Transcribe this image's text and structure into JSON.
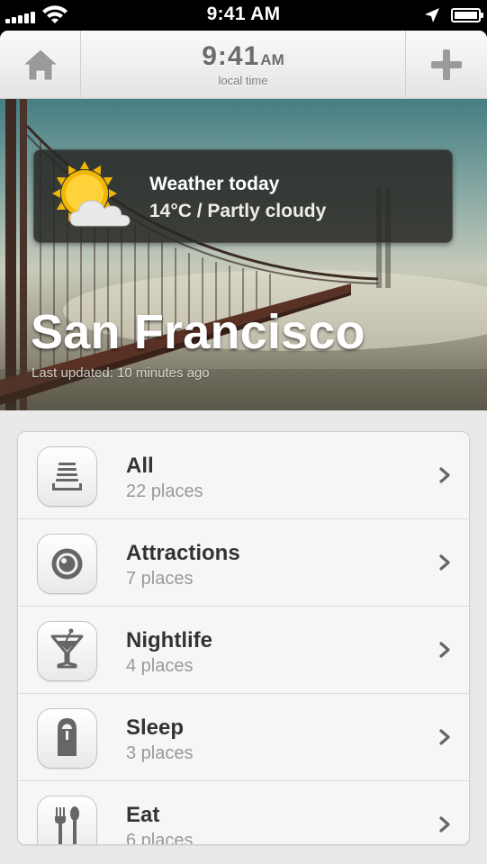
{
  "status_bar": {
    "time": "9:41 AM"
  },
  "nav": {
    "clock_time": "9:41",
    "clock_ampm": "AM",
    "clock_subtitle": "local time"
  },
  "weather": {
    "title": "Weather today",
    "description": "14°C / Partly cloudy",
    "icon": "partly-cloudy-icon"
  },
  "city": {
    "name": "San Francisco",
    "updated": "Last updated: 10 minutes ago"
  },
  "categories": [
    {
      "title": "All",
      "count": "22 places",
      "icon": "list-stack-icon"
    },
    {
      "title": "Attractions",
      "count": "7 places",
      "icon": "camera-lens-icon"
    },
    {
      "title": "Nightlife",
      "count": "4 places",
      "icon": "cocktail-icon"
    },
    {
      "title": "Sleep",
      "count": "3 places",
      "icon": "door-hanger-icon"
    },
    {
      "title": "Eat",
      "count": "6 places",
      "icon": "fork-knife-icon"
    }
  ],
  "colors": {
    "nav_text": "#6c6c6c",
    "accent_sun": "#f2b705",
    "list_title": "#333333",
    "list_subtitle": "#999999"
  }
}
